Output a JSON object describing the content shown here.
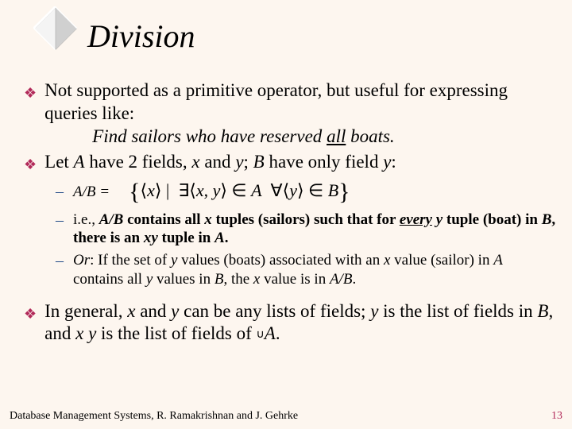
{
  "title": "Division",
  "bullet1": {
    "line1": "Not supported as a primitive operator, but useful for expressing queries like:",
    "line2_prefix": "Find sailors who have reserved ",
    "line2_underlined": "all",
    "line2_suffix": " boats."
  },
  "bullet2": {
    "prefix": "Let ",
    "A": "A",
    "mid1": " have 2 fields, ",
    "x": "x",
    "mid2": " and ",
    "y": "y",
    "mid3": "; ",
    "B": "B",
    "mid4": " have only field ",
    "y2": "y",
    "suffix": ":"
  },
  "sub1": {
    "label": "A/B =",
    "formula": "{⟨x⟩ | ∃⟨x, y⟩ ∈ A  ∀⟨y⟩ ∈ B}"
  },
  "sub2": {
    "p1": "i.e., ",
    "ab_bi": "A/B",
    "p2": " contains all ",
    "x_bi": "x",
    "p3": " tuples (sailors) such that for ",
    "every": "every",
    "p4": " ",
    "y_bi": "y",
    "p5": " tuple (boat) in ",
    "b_bi": "B",
    "p6": ", there is an ",
    "xy_bi": "xy",
    "p7": " tuple in ",
    "a_bi": "A",
    "p8": "."
  },
  "sub3": {
    "p1": "Or",
    "p2": ":  If the set of ",
    "y1": "y",
    "p3": " values (boats) associated with an ",
    "x1": "x",
    "p4": " value (sailor) in ",
    "a1": "A",
    "p5": " contains all ",
    "y2": "y",
    "p6": " values in ",
    "b1": "B",
    "p7": ", the ",
    "x2": "x",
    "p8": " value is in ",
    "ab": "A/B",
    "p9": "."
  },
  "bullet3": {
    "p1": "In general, ",
    "x1": "x",
    "p2": " and ",
    "y1": "y",
    "p3": " can be any lists of fields; ",
    "y2": "y",
    "p4": " is the list of fields in ",
    "b1": "B",
    "p5": ", and ",
    "x2": "x",
    "p6": "    ",
    "y3": "y",
    "p7": " is the list of fields of ",
    "a1": "A",
    "p8": ".",
    "cup": "∪"
  },
  "footer": {
    "left": "Database Management Systems, R. Ramakrishnan and J. Gehrke",
    "right": "13"
  }
}
